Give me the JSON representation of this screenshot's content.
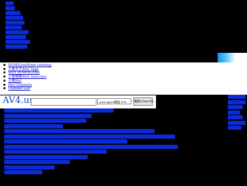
{
  "nav": {
    "items": [
      {
        "label": "HOME(realtime ranking)"
      },
      {
        "label": "人気タグ/Hot Tags"
      },
      {
        "label": "HOT DOWNLOAD"
      },
      {
        "label": "人気検索/Hot Searches"
      },
      {
        "label": "人気Hot"
      },
      {
        "label": "Hot Channels"
      },
      {
        "label": "Channel List"
      }
    ]
  },
  "search": {
    "logo_text": "AV4",
    "logo_suffix": ".us",
    "input_value": "",
    "select_value": "yuru space動画 H H",
    "button_label": "検索(Search)"
  },
  "colors": {
    "background": "#000000",
    "link_blue": "#0a2bd8",
    "logo_blue": "#1a3fb0"
  }
}
